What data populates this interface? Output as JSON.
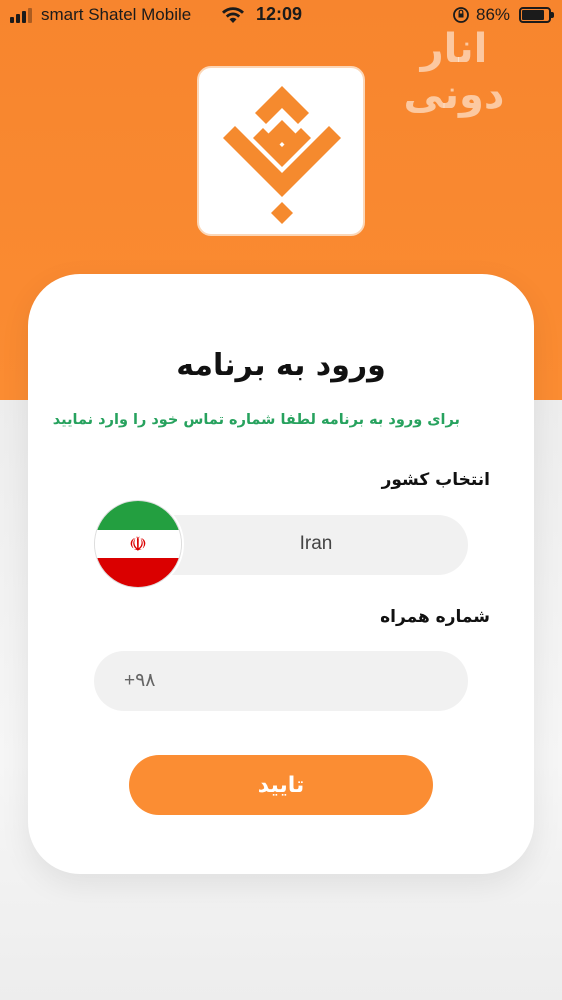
{
  "status_bar": {
    "carrier": "smart Shatel Mobile",
    "time": "12:09",
    "battery": "86%",
    "signal_icon": "signal-bars-icon",
    "wifi_icon": "wifi-icon",
    "orientation_icon": "orientation-lock-icon",
    "battery_level": 0.86
  },
  "watermark": "انار دونی",
  "colors": {
    "orange": "#fb8c32",
    "green_text": "#27a25e",
    "field_bg": "#f1f1f1"
  },
  "login": {
    "title": "ورود به برنامه",
    "subtitle": "برای ورود به برنامه لطفا شماره تماس خود را وارد نمایید",
    "country_label": "انتخاب کشور",
    "country_value": "Iran",
    "phone_label": "شماره همراه",
    "phone_placeholder": "+۹۸",
    "submit_label": "تایید"
  }
}
